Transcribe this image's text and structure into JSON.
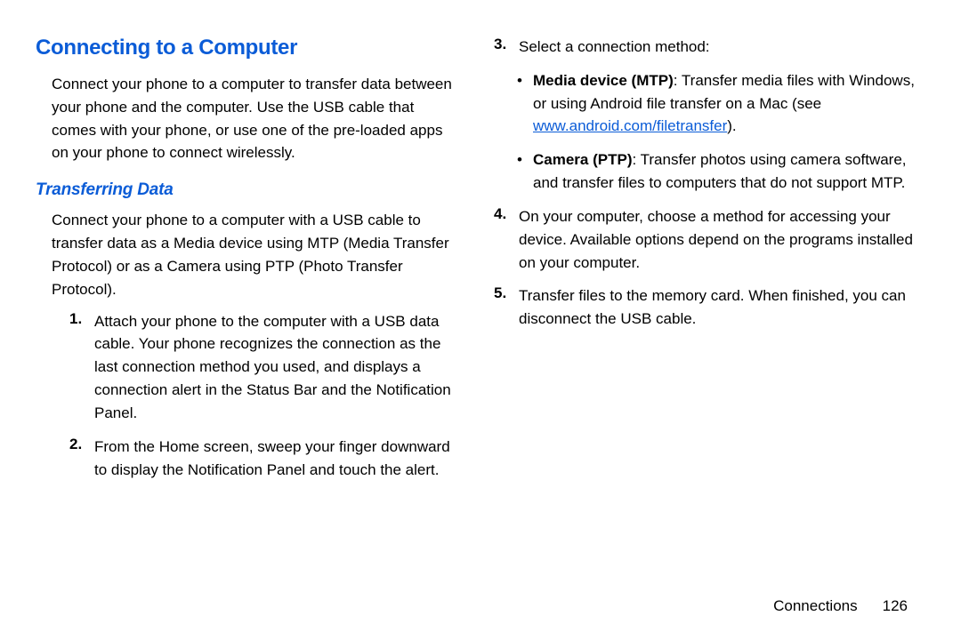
{
  "heading": "Connecting to a Computer",
  "intro": "Connect your phone to a computer to transfer data between your phone and the computer. Use the USB cable that comes with your phone, or use one of the pre-loaded apps on your phone to connect wirelessly.",
  "subheading": "Transferring Data",
  "subintro": "Connect your phone to a computer with a USB cable to transfer data as a Media device using MTP (Media Transfer Protocol) or as a Camera using PTP (Photo Transfer Protocol).",
  "steps": {
    "s1": {
      "num": "1.",
      "text": "Attach your phone to the computer with a USB data cable. Your phone recognizes the connection as the last connection method you used, and displays a connection alert in the Status Bar and the Notification Panel."
    },
    "s2": {
      "num": "2.",
      "text": "From the Home screen, sweep your finger downward to display the Notification Panel and touch the alert."
    },
    "s3": {
      "num": "3.",
      "text": "Select a connection method:"
    },
    "s4": {
      "num": "4.",
      "text": "On your computer, choose a method for accessing your device. Available options depend on the programs installed on your computer."
    },
    "s5": {
      "num": "5.",
      "text": "Transfer files to the memory card. When finished, you can disconnect the USB cable."
    }
  },
  "bullets": {
    "b1": {
      "mark": "•",
      "label": "Media device (MTP)",
      "text1": ": Transfer media files with Windows, or using Android file transfer on a Mac (see ",
      "link": "www.android.com/filetransfer",
      "text2": ")."
    },
    "b2": {
      "mark": "•",
      "label": "Camera (PTP)",
      "text": ": Transfer photos using camera software, and transfer files to computers that do not support MTP."
    }
  },
  "footer": {
    "section": "Connections",
    "page": "126"
  }
}
